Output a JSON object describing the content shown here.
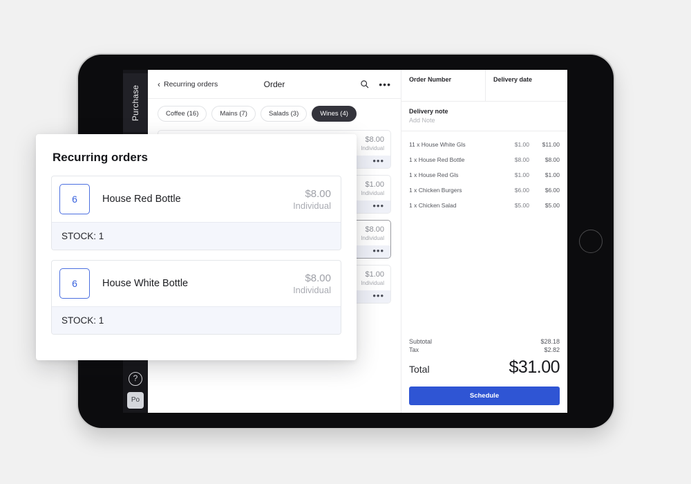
{
  "device": {
    "home_button_icon": "home-circle-icon"
  },
  "rail": {
    "tab_label": "Purchase",
    "help_icon": "question-mark-icon",
    "help_glyph": "?",
    "avatar_label": "Po"
  },
  "topbar": {
    "back_chevron": "‹",
    "back_label": "Recurring orders",
    "title": "Order",
    "search_icon": "search-icon",
    "more_icon": "more-horizontal-icon",
    "more_glyph": "•••"
  },
  "categories": [
    {
      "label": "Coffee (16)",
      "active": false
    },
    {
      "label": "Mains (7)",
      "active": false
    },
    {
      "label": "Salads (3)",
      "active": false
    },
    {
      "label": "Wines (4)",
      "active": true
    }
  ],
  "products": [
    {
      "price": "$8.00",
      "unit": "Individual",
      "menu_glyph": "•••",
      "selected": false
    },
    {
      "price": "$1.00",
      "unit": "Individual",
      "menu_glyph": "•••",
      "selected": false
    },
    {
      "price": "$8.00",
      "unit": "Individual",
      "menu_glyph": "•••",
      "selected": true
    },
    {
      "price": "$1.00",
      "unit": "Individual",
      "menu_glyph": "•••",
      "selected": false
    }
  ],
  "order_panel": {
    "columns": [
      {
        "label": "Order Number",
        "value": ""
      },
      {
        "label": "Delivery date",
        "value": ""
      }
    ],
    "delivery_note_label": "Delivery note",
    "delivery_note_placeholder": "Add Note",
    "line_items": [
      {
        "name": "11 x House White Gls",
        "unit_price": "$1.00",
        "total": "$11.00"
      },
      {
        "name": "1 x House Red Bottle",
        "unit_price": "$8.00",
        "total": "$8.00"
      },
      {
        "name": "1 x House Red Gls",
        "unit_price": "$1.00",
        "total": "$1.00"
      },
      {
        "name": "1 x Chicken Burgers",
        "unit_price": "$6.00",
        "total": "$6.00"
      },
      {
        "name": "1 x Chicken Salad",
        "unit_price": "$5.00",
        "total": "$5.00"
      }
    ],
    "subtotal_label": "Subtotal",
    "subtotal_value": "$28.18",
    "tax_label": "Tax",
    "tax_value": "$2.82",
    "total_label": "Total",
    "total_value": "$31.00",
    "schedule_label": "Schedule",
    "accent_color": "#2f55d4"
  },
  "modal": {
    "title": "Recurring orders",
    "items": [
      {
        "qty": "6",
        "name": "House Red Bottle",
        "price": "$8.00",
        "unit": "Individual",
        "stock": "STOCK: 1"
      },
      {
        "qty": "6",
        "name": "House White Bottle",
        "price": "$8.00",
        "unit": "Individual",
        "stock": "STOCK: 1"
      }
    ],
    "qty_border_color": "#4b6fe0"
  }
}
